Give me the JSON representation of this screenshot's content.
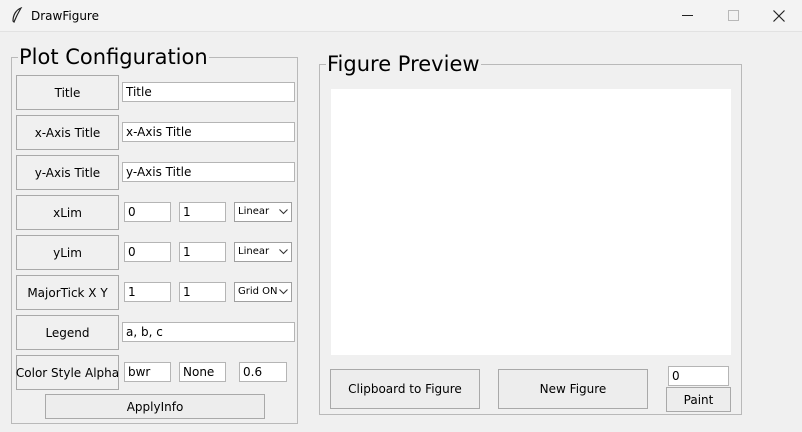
{
  "window": {
    "title": "DrawFigure"
  },
  "plot_config": {
    "group_title": "Plot Configuration",
    "title_label": "Title",
    "title_value": "Title",
    "xaxis_label": "x-Axis Title",
    "xaxis_value": "x-Axis Title",
    "yaxis_label": "y-Axis Title",
    "yaxis_value": "y-Axis Title",
    "xlim_label": "xLim",
    "xlim_min": "0",
    "xlim_max": "1",
    "xlim_scale": "Linear",
    "ylim_label": "yLim",
    "ylim_min": "0",
    "ylim_max": "1",
    "ylim_scale": "Linear",
    "majortick_label": "MajorTick X Y",
    "majortick_x": "1",
    "majortick_y": "1",
    "grid_select": "Grid ON",
    "legend_label": "Legend",
    "legend_value": "a, b, c",
    "color_label": "Color Style Alpha",
    "color_value": "bwr",
    "style_value": "None",
    "alpha_value": "0.6",
    "apply_button": "ApplyInfo"
  },
  "preview": {
    "group_title": "Figure Preview",
    "clipboard_button": "Clipboard to Figure",
    "new_figure_button": "New Figure",
    "paint_value": "0",
    "paint_button": "Paint"
  },
  "icons": {
    "app": "feather-icon",
    "minimize": "minimize-icon",
    "maximize": "maximize-icon",
    "close": "close-icon",
    "dropdown": "chevron-down-icon"
  }
}
